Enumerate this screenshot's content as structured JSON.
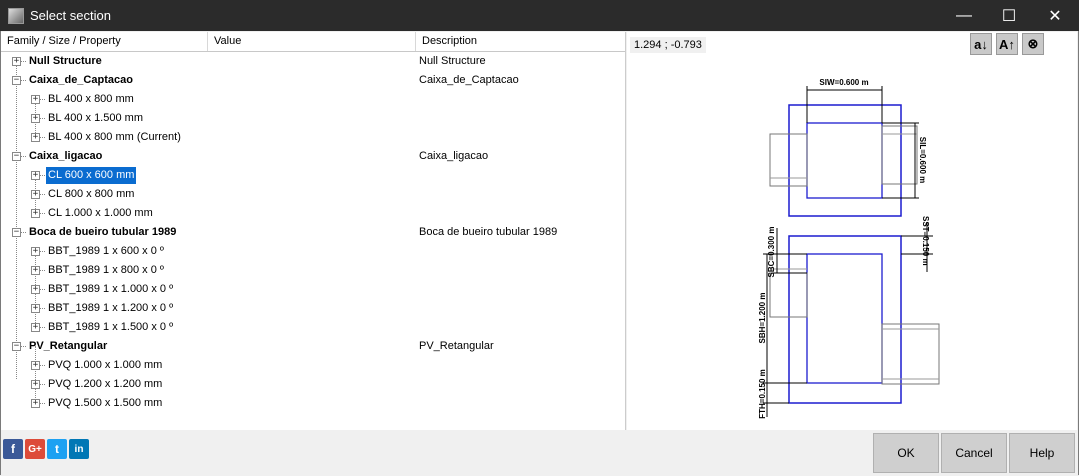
{
  "window": {
    "title": "Select section",
    "minimize": "—",
    "maximize": "☐",
    "close": "✕"
  },
  "columns": {
    "family": "Family / Size / Property",
    "value": "Value",
    "description": "Description"
  },
  "tree": [
    {
      "label": "Null Structure",
      "description": "Null Structure"
    },
    {
      "label": "Caixa_de_Captacao",
      "description": "Caixa_de_Captacao"
    },
    {
      "label": "BL 400 x 800 mm"
    },
    {
      "label": "BL 400 x 1.500 mm"
    },
    {
      "label": "BL 400 x 800 mm (Current)"
    },
    {
      "label": "Caixa_ligacao",
      "description": "Caixa_ligacao"
    },
    {
      "label": "CL 600 x 600 mm"
    },
    {
      "label": "CL 800 x 800 mm"
    },
    {
      "label": "CL 1.000 x 1.000 mm"
    },
    {
      "label": "Boca de bueiro tubular 1989",
      "description": "Boca de bueiro tubular 1989"
    },
    {
      "label": "BBT_1989 1 x 600 x 0 º"
    },
    {
      "label": "BBT_1989 1 x 800 x 0 º"
    },
    {
      "label": "BBT_1989 1 x 1.000 x 0 º"
    },
    {
      "label": "BBT_1989 1 x 1.200 x 0 º"
    },
    {
      "label": "BBT_1989 1 x 1.500 x 0 º"
    },
    {
      "label": "PV_Retangular",
      "description": "PV_Retangular"
    },
    {
      "label": "PVQ 1.000 x 1.000 mm"
    },
    {
      "label": "PVQ 1.200 x 1.200 mm"
    },
    {
      "label": "PVQ 1.500 x 1.500 mm"
    }
  ],
  "preview": {
    "coords": "1.294 ; -0.793",
    "sort_asc": "a↓",
    "sort_desc": "A↑",
    "zoom": "⊗",
    "dims": {
      "siw": "SIW=0.600 m",
      "sil": "SIL=0.600 m",
      "sst": "SST=0.150 m",
      "sbc": "SBC=0.300 m",
      "sbh": "SBH=1.200 m",
      "fth": "FTH=0.150 m"
    }
  },
  "social": {
    "facebook": "f",
    "google": "G+",
    "twitter": "t",
    "linkedin": "in"
  },
  "buttons": {
    "ok": "OK",
    "cancel": "Cancel",
    "help": "Help"
  },
  "colors": {
    "selection": "#0a6cd0",
    "outline": "#1c1ccf",
    "titlebar": "#2b2b2b"
  }
}
